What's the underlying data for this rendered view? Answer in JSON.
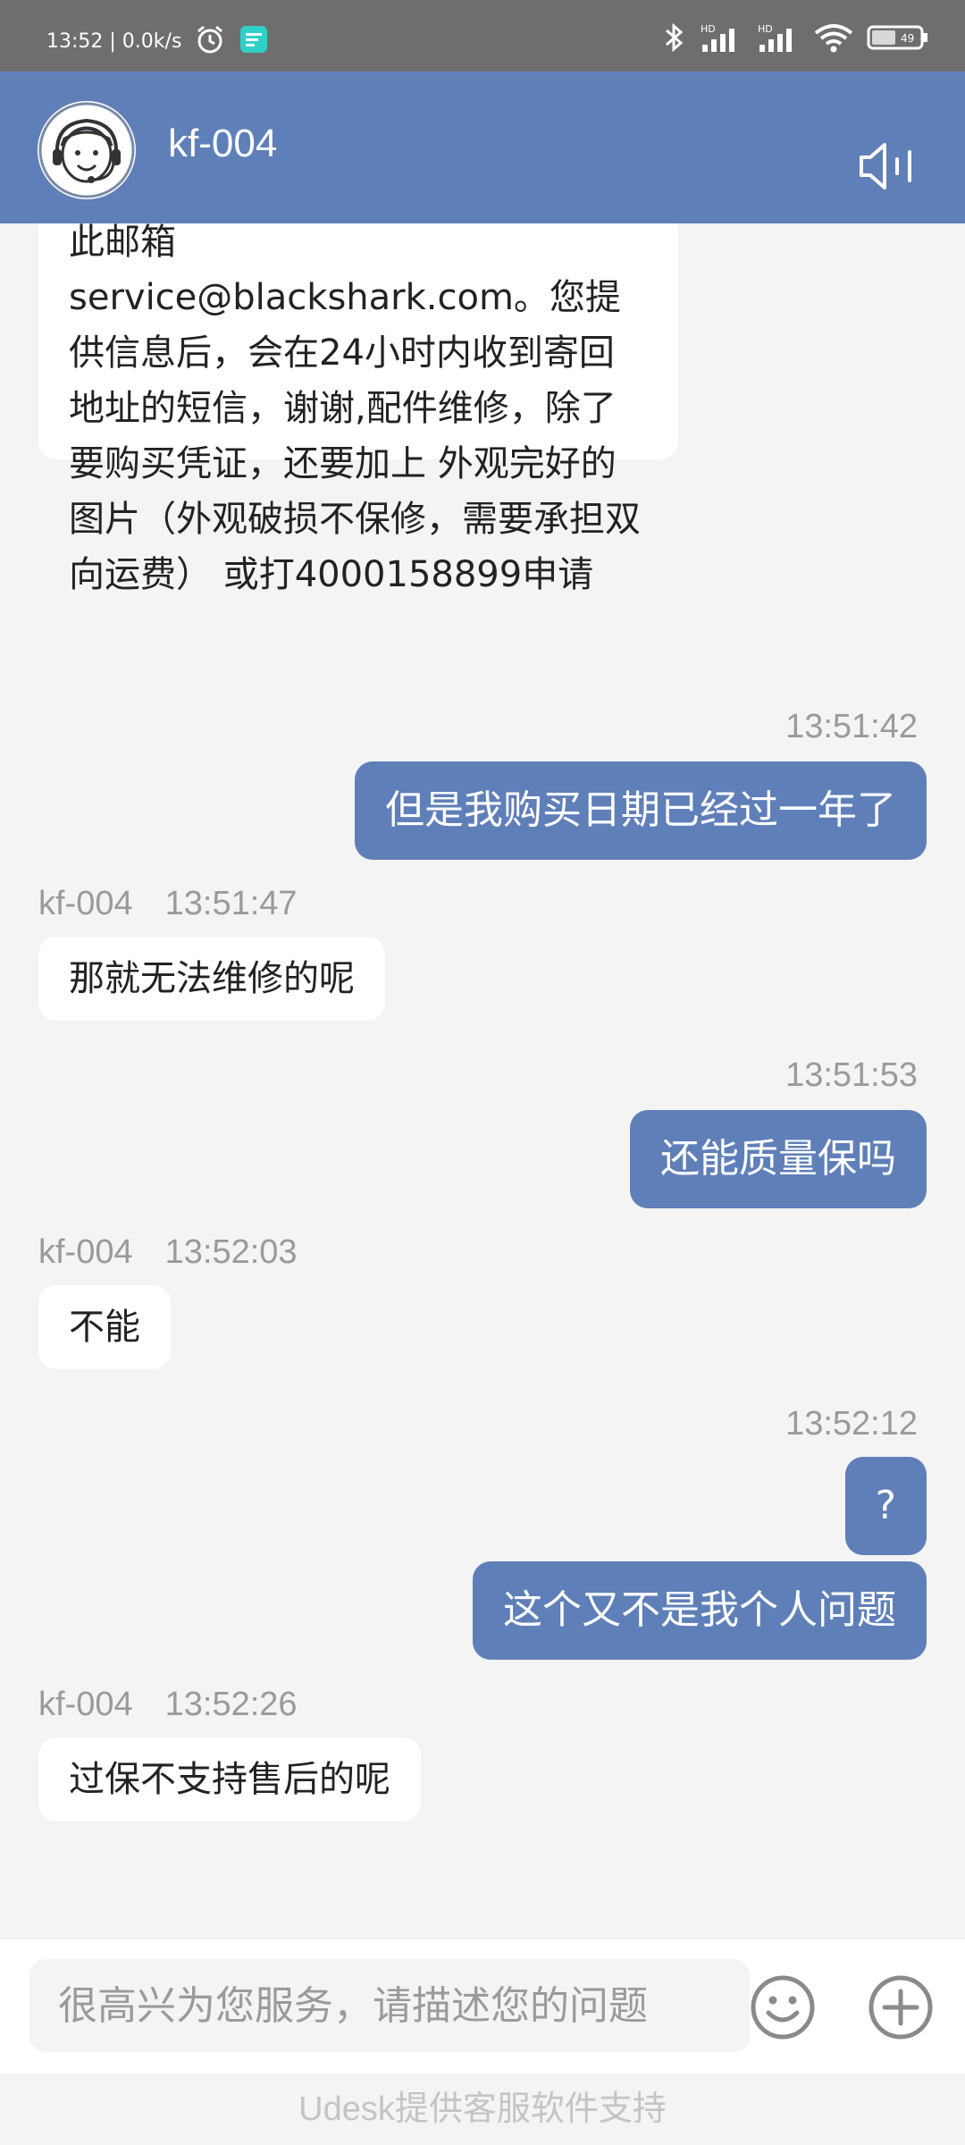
{
  "status_bar": {
    "time_speed": "13:52 | 0.0k/s",
    "battery": "49",
    "signal1_label": "HD",
    "signal2_label": "HD"
  },
  "header": {
    "title": "kf-004"
  },
  "messages": [
    {
      "side": "in",
      "text": "此邮箱\nservice@blackshark.com。您提供信息后，会在24小时内收到寄回地址的短信，谢谢,配件维修，除了要购买凭证，还要加上 外观完好的图片（外观破损不保修，需要承担双向运费） 或打4000158899申请"
    },
    {
      "side": "out",
      "time": "13:51:42",
      "text": "但是我购买日期已经过一年了"
    },
    {
      "side": "in",
      "agent": "kf-004",
      "time": "13:51:47",
      "text": "那就无法维修的呢"
    },
    {
      "side": "out",
      "time": "13:51:53",
      "text": "还能质量保吗"
    },
    {
      "side": "in",
      "agent": "kf-004",
      "time": "13:52:03",
      "text": "不能"
    },
    {
      "side": "out",
      "time": "13:52:12",
      "text": "?"
    },
    {
      "side": "out",
      "text": "这个又不是我个人问题"
    },
    {
      "side": "in",
      "agent": "kf-004",
      "time": "13:52:26",
      "text": "过保不支持售后的呢"
    }
  ],
  "input": {
    "placeholder": "很高兴为您服务，请描述您的问题"
  },
  "footer": {
    "text": "Udesk提供客服软件支持"
  },
  "colors": {
    "accent": "#5f7fb9",
    "status_bar": "#6e6e6e",
    "background": "#f4f4f4"
  },
  "icons": {
    "alarm": "alarm-icon",
    "message": "message-notification-icon",
    "bluetooth": "bluetooth-icon",
    "wifi": "wifi-icon",
    "battery": "battery-icon",
    "speaker": "speaker-icon",
    "emoji": "emoji-icon",
    "plus": "plus-icon"
  }
}
